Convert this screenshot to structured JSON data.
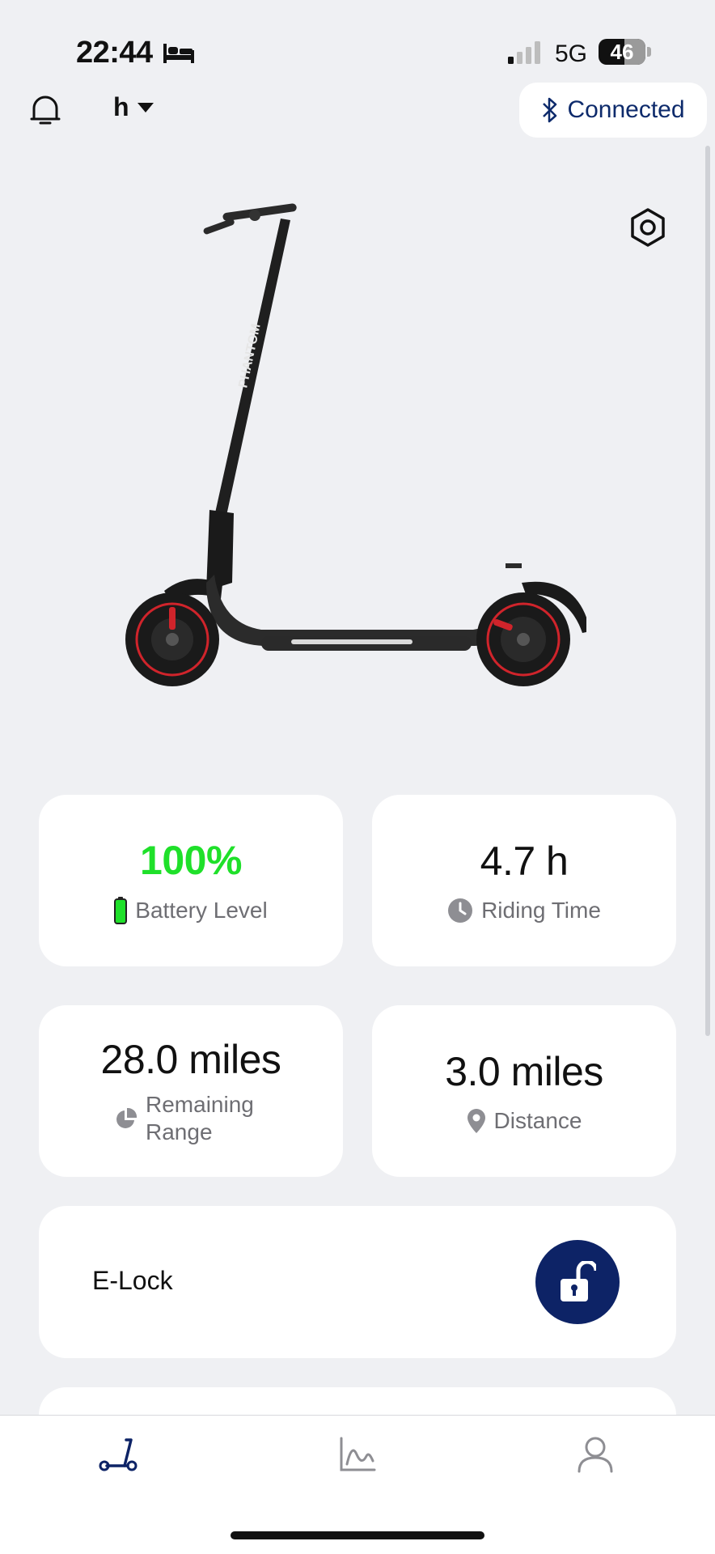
{
  "status_bar": {
    "time": "22:44",
    "network": "5G",
    "battery": "46"
  },
  "header": {
    "device_name": "h",
    "connection_status": "Connected"
  },
  "scooter": {
    "brand_text": "PHANTOM"
  },
  "stats": {
    "battery": {
      "value": "100%",
      "label": "Battery Level",
      "accent": "#1fe02a"
    },
    "riding_time": {
      "value": "4.7 h",
      "label": "Riding Time"
    },
    "remaining_range": {
      "value": "28.0 miles",
      "label": "Remaining Range"
    },
    "distance": {
      "value": "3.0 miles",
      "label": "Distance"
    }
  },
  "elock": {
    "label": "E-Lock",
    "state_icon": "unlocked-padlock-icon"
  },
  "tab_bar": {
    "tabs": [
      {
        "icon": "scooter-tab-icon",
        "active": true
      },
      {
        "icon": "stats-chart-icon",
        "active": false
      },
      {
        "icon": "profile-icon",
        "active": false
      }
    ]
  },
  "colors": {
    "brand_navy": "#0d2366",
    "background": "#eff0f3",
    "battery_green": "#1fe02a"
  }
}
